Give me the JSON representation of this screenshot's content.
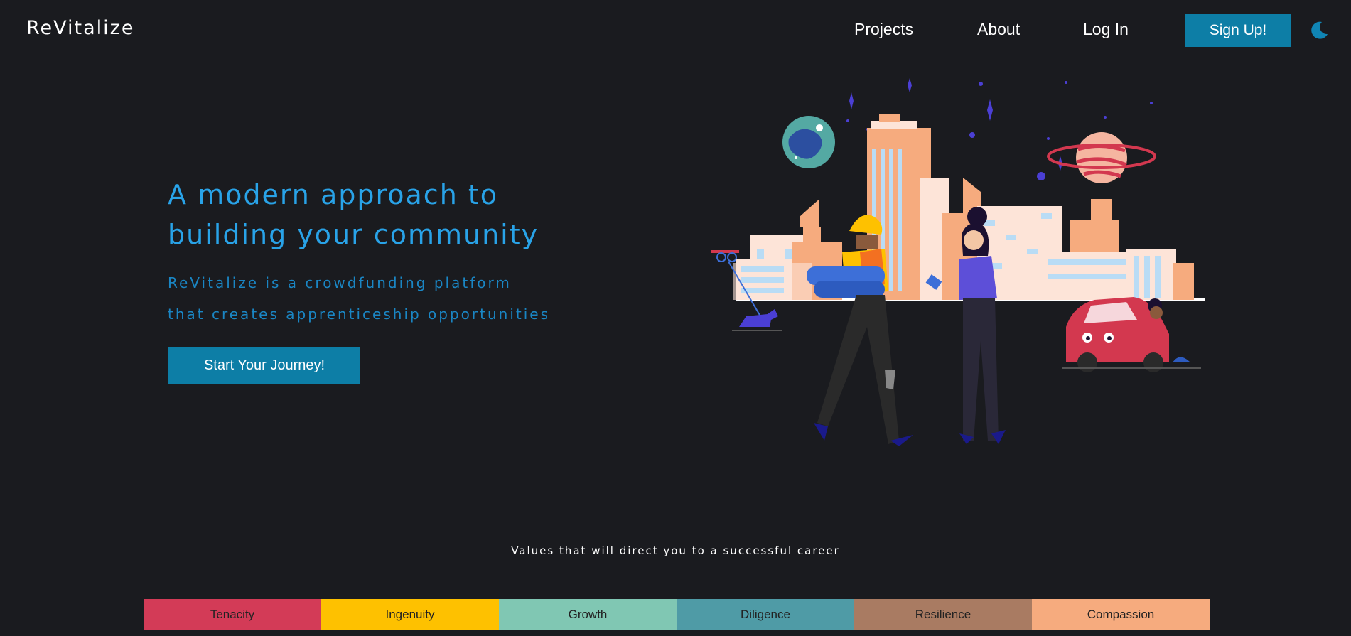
{
  "nav": {
    "logo": "ReVitalize",
    "links": [
      {
        "label": "Projects"
      },
      {
        "label": "About"
      },
      {
        "label": "Log In"
      }
    ],
    "signup_label": "Sign Up!",
    "theme_icon": "moon-icon"
  },
  "hero": {
    "title_line1": "A modern approach to",
    "title_line2": "building your community",
    "subtitle_line1": "ReVitalize is a crowdfunding platform",
    "subtitle_line2": "that creates apprenticeship opportunities",
    "cta_label": "Start Your Journey!"
  },
  "values": {
    "caption": "Values that will direct you to a successful career",
    "items": [
      {
        "label": "Tenacity",
        "color": "#d33b57"
      },
      {
        "label": "Ingenuity",
        "color": "#fec100"
      },
      {
        "label": "Growth",
        "color": "#80c7b3"
      },
      {
        "label": "Diligence",
        "color": "#4f9ba6"
      },
      {
        "label": "Resilience",
        "color": "#a97b62"
      },
      {
        "label": "Compassion",
        "color": "#f6ab7e"
      }
    ]
  },
  "colors": {
    "background": "#1a1b1f",
    "accent": "#0d7ea6",
    "heading": "#29a3e8",
    "subheading": "#1a86c4"
  }
}
